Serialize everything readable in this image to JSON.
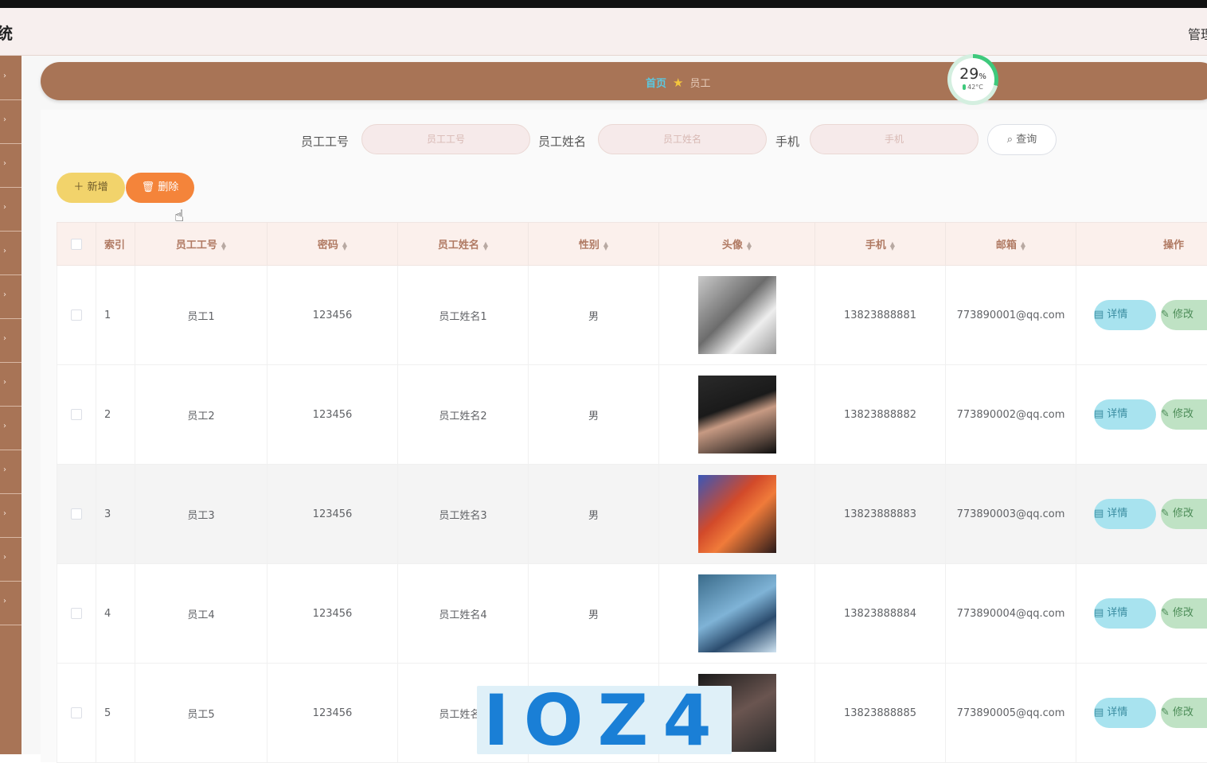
{
  "header": {
    "title": "统",
    "user": "管理"
  },
  "sidebar": {
    "items": [
      "",
      "",
      "",
      "",
      "",
      "",
      "",
      "",
      "",
      "",
      "",
      "",
      "",
      ""
    ]
  },
  "breadcrumb": {
    "home": "首页",
    "current": "员工"
  },
  "gauge": {
    "percent": "29",
    "percent_unit": "%",
    "temp": "42°C",
    "fraction": 0.29
  },
  "search": {
    "label_id": "员工工号",
    "placeholder_id": "员工工号",
    "label_name": "员工姓名",
    "placeholder_name": "员工姓名",
    "label_phone": "手机",
    "placeholder_phone": "手机",
    "query_button": "查询"
  },
  "actions": {
    "add": "新增",
    "delete": "删除"
  },
  "table": {
    "columns": [
      "索引",
      "员工工号",
      "密码",
      "员工姓名",
      "性别",
      "头像",
      "手机",
      "邮箱",
      "操作"
    ],
    "rows": [
      {
        "index": "1",
        "emp_id": "员工1",
        "password": "123456",
        "name": "员工姓名1",
        "gender": "男",
        "phone": "13823888881",
        "email": "773890001@qq.com"
      },
      {
        "index": "2",
        "emp_id": "员工2",
        "password": "123456",
        "name": "员工姓名2",
        "gender": "男",
        "phone": "13823888882",
        "email": "773890002@qq.com"
      },
      {
        "index": "3",
        "emp_id": "员工3",
        "password": "123456",
        "name": "员工姓名3",
        "gender": "男",
        "phone": "13823888883",
        "email": "773890003@qq.com"
      },
      {
        "index": "4",
        "emp_id": "员工4",
        "password": "123456",
        "name": "员工姓名4",
        "gender": "男",
        "phone": "13823888884",
        "email": "773890004@qq.com"
      },
      {
        "index": "5",
        "emp_id": "员工5",
        "password": "123456",
        "name": "员工姓名5",
        "gender": "",
        "phone": "13823888885",
        "email": "773890005@qq.com"
      }
    ],
    "detail_label": "详情",
    "edit_label": "修改"
  },
  "watermark": {
    "text": "IOZ4"
  },
  "colors": {
    "accent": "#a87456",
    "header_bg": "#f7efee",
    "add": "#f2d36b",
    "delete": "#f4843a",
    "detail": "#a8e3ef",
    "edit": "#bfe2c4"
  }
}
